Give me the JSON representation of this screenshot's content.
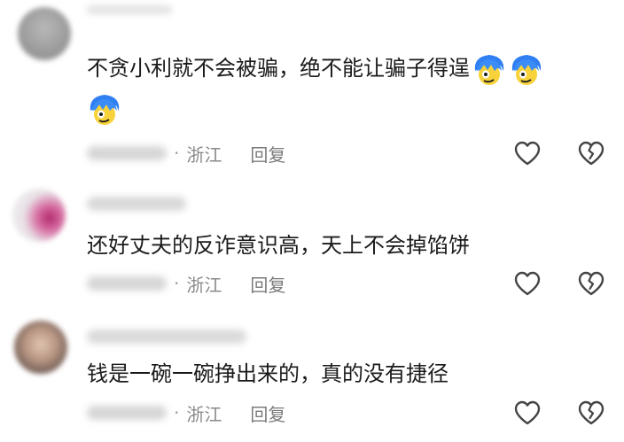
{
  "comments": [
    {
      "text": "不贪小利就不会被骗，绝不能让骗子得逞",
      "region": "浙江",
      "reply_label": "回复",
      "emoji_count": 3
    },
    {
      "text": "还好丈夫的反诈意识高，天上不会掉馅饼",
      "region": "浙江",
      "reply_label": "回复"
    },
    {
      "text": "钱是一碗一碗挣出来的，真的没有捷径",
      "region": "浙江",
      "reply_label": "回复"
    }
  ],
  "meta_separator": "·",
  "icons": {
    "like": "heart-outline-icon",
    "dislike": "broken-heart-outline-icon",
    "emoji": "blue-hair-face-emoji"
  },
  "colors": {
    "text": "#1a1a1a",
    "meta": "#8a8a8a",
    "icon_stroke": "#444444"
  }
}
